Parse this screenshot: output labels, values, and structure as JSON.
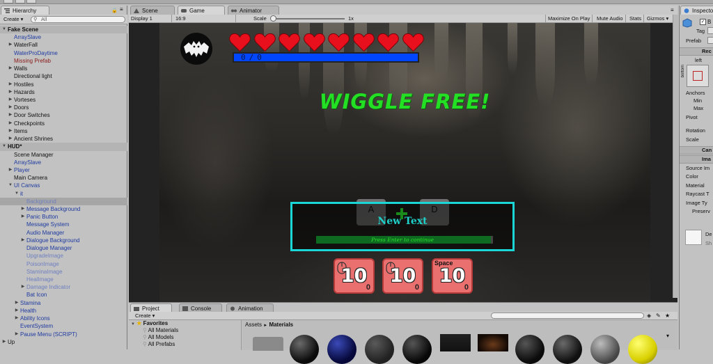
{
  "hierarchy": {
    "tab": "Hierarchy",
    "create": "Create ▾",
    "search_placeholder": "All",
    "rows": [
      {
        "label": "Fake Scene",
        "indent": 0,
        "arrow": "▼",
        "kind": "scene"
      },
      {
        "label": "ArraySlave",
        "indent": 1,
        "arrow": "",
        "kind": "blue"
      },
      {
        "label": "WaterFall",
        "indent": 1,
        "arrow": "▶",
        "kind": "dark"
      },
      {
        "label": "WaterProDaytime",
        "indent": 1,
        "arrow": "",
        "kind": "blue"
      },
      {
        "label": "Missing Prefab",
        "indent": 1,
        "arrow": "",
        "kind": "red"
      },
      {
        "label": "Walls",
        "indent": 1,
        "arrow": "▶",
        "kind": "dark"
      },
      {
        "label": "Directional light",
        "indent": 1,
        "arrow": "",
        "kind": "dark"
      },
      {
        "label": "Hostiles",
        "indent": 1,
        "arrow": "▶",
        "kind": "dark"
      },
      {
        "label": "Hazards",
        "indent": 1,
        "arrow": "▶",
        "kind": "dark"
      },
      {
        "label": "Vorteses",
        "indent": 1,
        "arrow": "▶",
        "kind": "dark"
      },
      {
        "label": "Doors",
        "indent": 1,
        "arrow": "▶",
        "kind": "dark"
      },
      {
        "label": "Door Switches",
        "indent": 1,
        "arrow": "▶",
        "kind": "dark"
      },
      {
        "label": "Checkpoints",
        "indent": 1,
        "arrow": "▶",
        "kind": "dark"
      },
      {
        "label": "Items",
        "indent": 1,
        "arrow": "▶",
        "kind": "dark"
      },
      {
        "label": "Ancient Shrines",
        "indent": 1,
        "arrow": "▶",
        "kind": "dark"
      },
      {
        "label": "HUD*",
        "indent": 0,
        "arrow": "▼",
        "kind": "scene2"
      },
      {
        "label": "Scene Manager",
        "indent": 1,
        "arrow": "",
        "kind": "dark"
      },
      {
        "label": "ArraySlave",
        "indent": 1,
        "arrow": "",
        "kind": "blue"
      },
      {
        "label": "Player",
        "indent": 1,
        "arrow": "▶",
        "kind": "blue"
      },
      {
        "label": "Main Camera",
        "indent": 1,
        "arrow": "",
        "kind": "dark"
      },
      {
        "label": "UI Canvas",
        "indent": 1,
        "arrow": "▼",
        "kind": "blue"
      },
      {
        "label": "it",
        "indent": 2,
        "arrow": "▼",
        "kind": "blue"
      },
      {
        "label": "Background",
        "indent": 3,
        "arrow": "",
        "kind": "blue-light",
        "selected": true
      },
      {
        "label": "Message Background",
        "indent": 3,
        "arrow": "▶",
        "kind": "blue"
      },
      {
        "label": "Panic Button",
        "indent": 3,
        "arrow": "▶",
        "kind": "blue"
      },
      {
        "label": "Message System",
        "indent": 3,
        "arrow": "",
        "kind": "blue"
      },
      {
        "label": "Audio Manager",
        "indent": 3,
        "arrow": "",
        "kind": "blue"
      },
      {
        "label": "Dialogue Background",
        "indent": 3,
        "arrow": "▶",
        "kind": "blue"
      },
      {
        "label": "Dialogue Manager",
        "indent": 3,
        "arrow": "",
        "kind": "blue"
      },
      {
        "label": "UpgradeImage",
        "indent": 3,
        "arrow": "",
        "kind": "blue-light"
      },
      {
        "label": "PoisonImage",
        "indent": 3,
        "arrow": "",
        "kind": "blue-light"
      },
      {
        "label": "StaminaImage",
        "indent": 3,
        "arrow": "",
        "kind": "blue-light"
      },
      {
        "label": "HealImage",
        "indent": 3,
        "arrow": "",
        "kind": "blue-light"
      },
      {
        "label": "Damage Indicator",
        "indent": 3,
        "arrow": "▶",
        "kind": "blue-light"
      },
      {
        "label": "Bat Icon",
        "indent": 3,
        "arrow": "",
        "kind": "blue"
      },
      {
        "label": "Stamina",
        "indent": 2,
        "arrow": "▶",
        "kind": "blue"
      },
      {
        "label": "Health",
        "indent": 2,
        "arrow": "▶",
        "kind": "blue"
      },
      {
        "label": "Ability Icons",
        "indent": 2,
        "arrow": "▶",
        "kind": "blue"
      },
      {
        "label": "EventSystem",
        "indent": 2,
        "arrow": "",
        "kind": "blue"
      },
      {
        "label": "Pause Menu (SCRIPT)",
        "indent": 2,
        "arrow": "▶",
        "kind": "blue"
      },
      {
        "label": "Up",
        "indent": 0,
        "arrow": "▶",
        "kind": "dark"
      }
    ]
  },
  "tabs": {
    "scene": "Scene",
    "game": "Game",
    "animator": "Animator"
  },
  "game_toolbar": {
    "display": "Display 1",
    "aspect": "16:9",
    "scale_label": "Scale",
    "scale_value": "1x",
    "maximize": "Maximize On Play",
    "mute": "Mute Audio",
    "stats": "Stats",
    "gizmos": "Gizmos ▾"
  },
  "game": {
    "health_bar_text": "0/0",
    "hearts_count": 8,
    "heart_color": "#e8101c",
    "banner": "WIGGLE FREE!",
    "key_a": "A",
    "key_d": "D",
    "dialog_title": "New Text",
    "dialog_hint": "Press Enter to continue",
    "abilities": [
      {
        "key": "",
        "icon": "mouse-icon",
        "value": "10",
        "count": "0"
      },
      {
        "key": "",
        "icon": "mouse-icon",
        "value": "10",
        "count": "0"
      },
      {
        "key": "Space",
        "icon": "",
        "value": "10",
        "count": "0"
      }
    ],
    "accent_cyan": "#1bd6d6",
    "accent_green": "#24e024"
  },
  "inspector": {
    "tab": "Inspecto",
    "tag_label": "Tag",
    "prefab_label": "Prefab",
    "rect_label": "Rec",
    "left_label": "left",
    "bottom_label": "bottom",
    "anchors": "Anchors",
    "min": "Min",
    "max": "Max",
    "pivot": "Pivot",
    "rotation": "Rotation",
    "scale": "Scale",
    "canvas_header": "Can",
    "image_header": "Ima",
    "source": "Source Im",
    "color": "Color",
    "material": "Material",
    "raycast": "Raycast T",
    "image_type": "Image Ty",
    "preserve": "Preserv",
    "default": "De",
    "sh": "Sh"
  },
  "project": {
    "tab_project": "Project",
    "tab_console": "Console",
    "tab_animation": "Animation",
    "create": "Create ▾",
    "favorites": "Favorites",
    "fav_items": [
      "All Materials",
      "All Models",
      "All Prefabs"
    ],
    "breadcrumb_root": "Assets",
    "breadcrumb_sep": "►",
    "breadcrumb_current": "Materials"
  }
}
